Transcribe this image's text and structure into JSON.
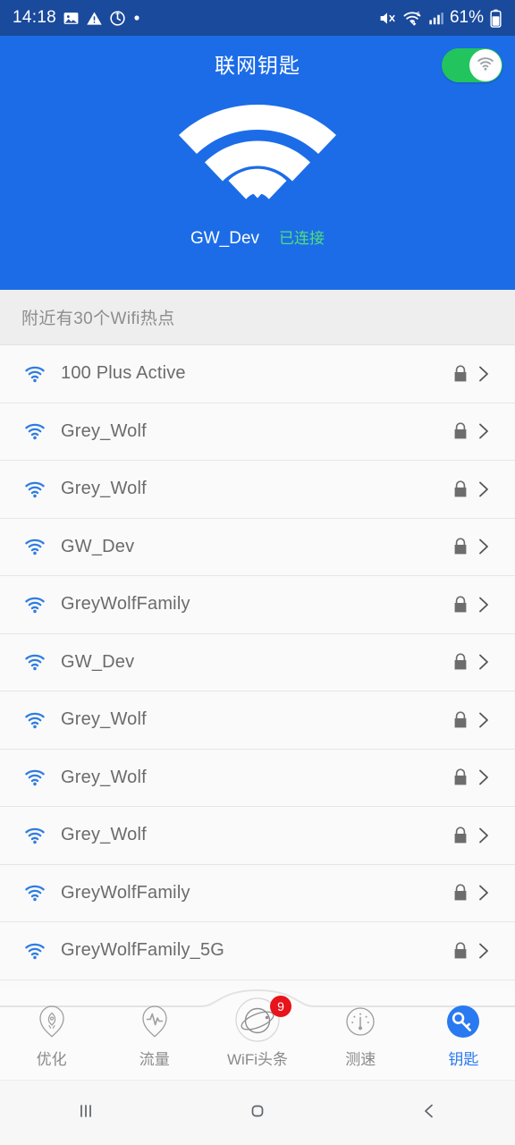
{
  "statusbar": {
    "time": "14:18",
    "battery_percent": "61%",
    "left_icons": [
      "image-icon",
      "warning-icon",
      "alarm-history-icon",
      "dot-icon"
    ],
    "right_icons": [
      "mute-icon",
      "wifi-6-icon",
      "signal-bars-icon",
      "battery-icon"
    ]
  },
  "header": {
    "title": "联网钥匙",
    "toggle": {
      "name": "wifi-master-toggle",
      "state": "on",
      "color": "#22c45e"
    },
    "hero": {
      "ssid": "GW_Dev",
      "status": "已连接",
      "status_color": "#4ee07a"
    }
  },
  "section": {
    "label": "附近有30个Wifi热点"
  },
  "networks": [
    {
      "ssid": "100 Plus Active",
      "secured": true
    },
    {
      "ssid": "Grey_Wolf",
      "secured": true
    },
    {
      "ssid": "Grey_Wolf",
      "secured": true
    },
    {
      "ssid": "GW_Dev",
      "secured": true
    },
    {
      "ssid": "GreyWolfFamily",
      "secured": true
    },
    {
      "ssid": "GW_Dev",
      "secured": true
    },
    {
      "ssid": "Grey_Wolf",
      "secured": true
    },
    {
      "ssid": "Grey_Wolf",
      "secured": true
    },
    {
      "ssid": "Grey_Wolf",
      "secured": true
    },
    {
      "ssid": "GreyWolfFamily",
      "secured": true
    },
    {
      "ssid": "GreyWolfFamily_5G",
      "secured": true
    }
  ],
  "bottom_nav": {
    "active_color": "#2979f0",
    "items": [
      {
        "label": "优化",
        "icon": "rocket-icon",
        "active": false
      },
      {
        "label": "流量",
        "icon": "pulse-icon",
        "active": false
      },
      {
        "label": "WiFi头条",
        "icon": "planet-icon",
        "active": false,
        "badge": "9"
      },
      {
        "label": "测速",
        "icon": "speedometer-icon",
        "active": false
      },
      {
        "label": "钥匙",
        "icon": "key-icon",
        "active": true
      }
    ]
  },
  "android_nav": {
    "recents": "recents-icon",
    "home": "home-icon",
    "back": "back-icon"
  }
}
